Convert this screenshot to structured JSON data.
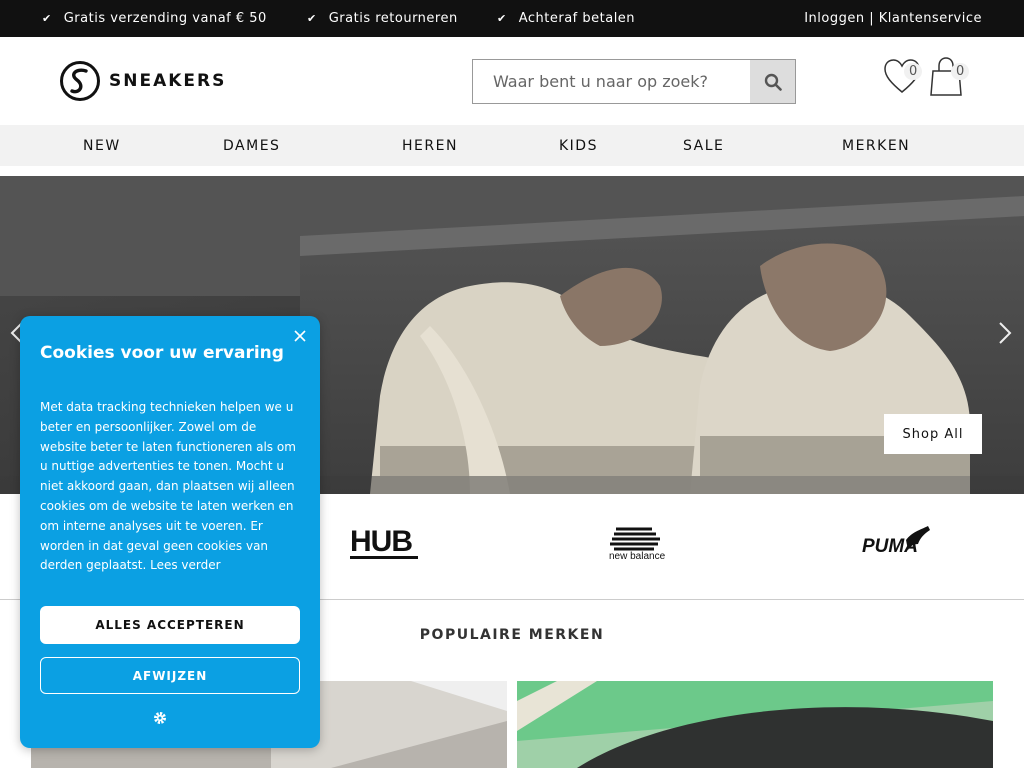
{
  "topbar": {
    "usps": [
      "Gratis verzending vanaf € 50",
      "Gratis retourneren",
      "Achteraf betalen"
    ],
    "check_glyph": "✔",
    "login": "Inloggen",
    "separator": " | ",
    "service": "Klantenservice"
  },
  "header": {
    "logo_text": "SNEAKERS",
    "search_placeholder": "Waar bent u naar op zoek?",
    "wishlist_count": "0",
    "cart_count": "0"
  },
  "nav": [
    "NEW",
    "DAMES",
    "HEREN",
    "KIDS",
    "SALE",
    "MERKEN"
  ],
  "hero": {
    "cta": "Shop All"
  },
  "brands": {
    "hub": "HUB",
    "newbalance": "new balance",
    "puma": "PUMA"
  },
  "popular_title": "POPULAIRE MERKEN",
  "cookie": {
    "title": "Cookies voor uw ervaring",
    "body": "Met data tracking technieken helpen we u beter en persoonlijker. Zowel om de website beter te laten functioneren als om u nuttige advertenties te tonen. Mocht u niet akkoord gaan, dan plaatsen wij alleen cookies om de website te laten werken en om interne analyses uit te voeren. Er worden in dat geval geen cookies van derden geplaatst. Lees verder",
    "accept": "ALLES ACCEPTEREN",
    "decline": "AFWIJZEN"
  },
  "colors": {
    "topbar": "#111111",
    "cookie": "#0ba0e3",
    "nav_bg": "#f2f2f2"
  },
  "icons": [
    "check-icon",
    "search-icon",
    "heart-icon",
    "bag-icon",
    "chevron-left-icon",
    "chevron-right-icon",
    "close-icon",
    "gear-icon"
  ]
}
